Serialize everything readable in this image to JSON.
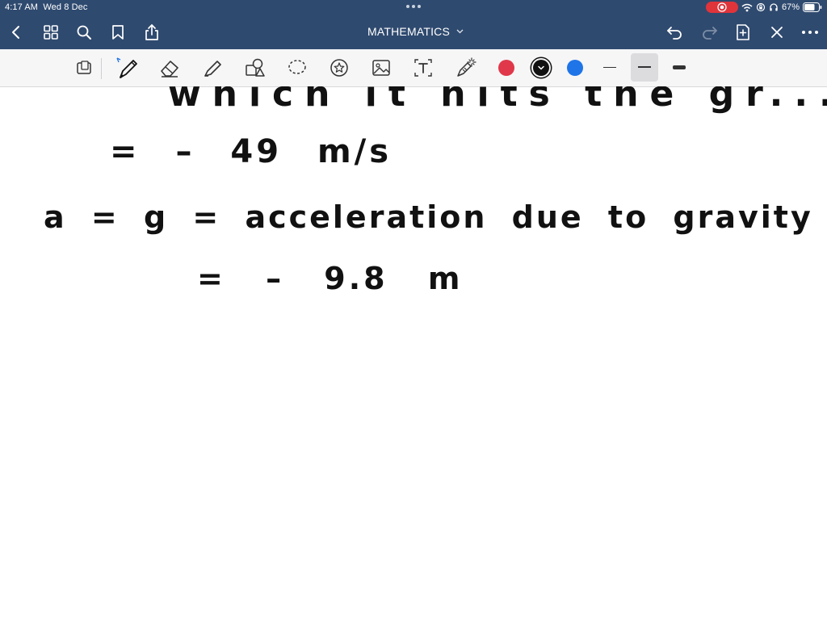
{
  "status_bar": {
    "time": "4:17 AM",
    "date": "Wed 8 Dec",
    "battery": "67%"
  },
  "header": {
    "title": "MATHEMATICS",
    "title_icon": "chevron-down-icon"
  },
  "toolbar": {
    "tools": [
      "page-layout-icon",
      "pen-icon",
      "eraser-icon",
      "highlighter-icon",
      "shapes-icon",
      "lasso-icon",
      "sticker-icon",
      "image-icon",
      "text-tool-icon",
      "laser-pointer-icon"
    ],
    "colors": [
      "#e0384a",
      "#111111",
      "#1f74e8"
    ],
    "selected_color": "#111111",
    "stroke_widths": [
      "thin",
      "medium",
      "thick"
    ],
    "selected_stroke": "medium"
  },
  "notes": {
    "line1": "which it hits the gr...",
    "line2": "= – 49 m/s",
    "line3": "a = g = acceleration due to gravity",
    "line4": "= – 9.8 m"
  }
}
